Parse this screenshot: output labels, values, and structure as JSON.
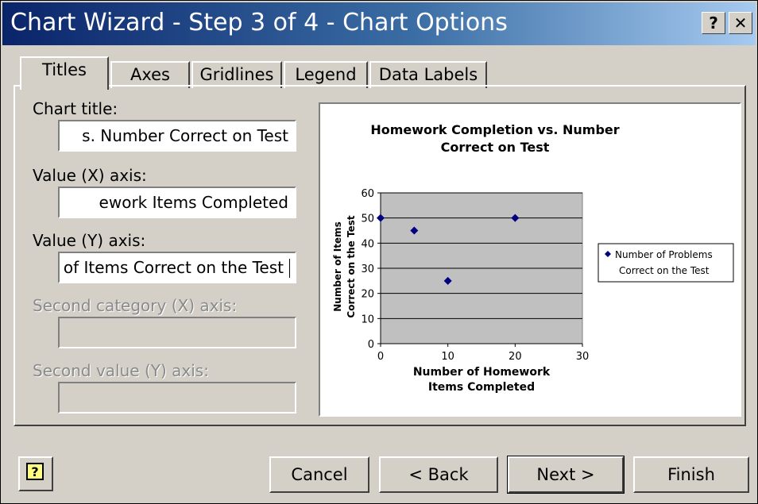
{
  "window": {
    "title": "Chart Wizard - Step 3 of 4 - Chart Options",
    "help_glyph": "?",
    "close_glyph": "✕"
  },
  "tabs": [
    {
      "label": "Titles"
    },
    {
      "label": "Axes"
    },
    {
      "label": "Gridlines"
    },
    {
      "label": "Legend"
    },
    {
      "label": "Data Labels"
    }
  ],
  "form": {
    "chart_title_label": "Chart title:",
    "chart_title_value": "s. Number Correct on Test",
    "x_axis_label": "Value (X) axis:",
    "x_axis_value": "ework Items Completed",
    "y_axis_label": "Value (Y) axis:",
    "y_axis_value": "of Items Correct on the Test",
    "second_x_label": "Second category (X) axis:",
    "second_x_value": "",
    "second_y_label": "Second value (Y) axis:",
    "second_y_value": ""
  },
  "chart_data": {
    "type": "scatter",
    "title": "Homework Completion vs. Number Correct on Test",
    "title_lines": [
      "Homework Completion vs. Number",
      "Correct on Test"
    ],
    "xlabel_lines": [
      "Number of Homework",
      "Items Completed"
    ],
    "ylabel_lines": [
      "Number of Items",
      "Correct on the Test"
    ],
    "xlim": [
      0,
      30
    ],
    "ylim": [
      0,
      60
    ],
    "x_ticks": [
      0,
      10,
      20,
      30
    ],
    "y_ticks": [
      0,
      10,
      20,
      30,
      40,
      50,
      60
    ],
    "grid": true,
    "plot_bg": "#c0c0c0",
    "marker_color": "#000080",
    "legend_position": "right",
    "legend_lines": [
      "Number of Problems",
      "Correct on the Test"
    ],
    "series": [
      {
        "x": [
          0,
          5,
          10,
          20
        ],
        "y": [
          50,
          45,
          25,
          50
        ]
      }
    ]
  },
  "buttons": {
    "cancel": "Cancel",
    "back": "< Back",
    "next": "Next >",
    "finish": "Finish"
  }
}
